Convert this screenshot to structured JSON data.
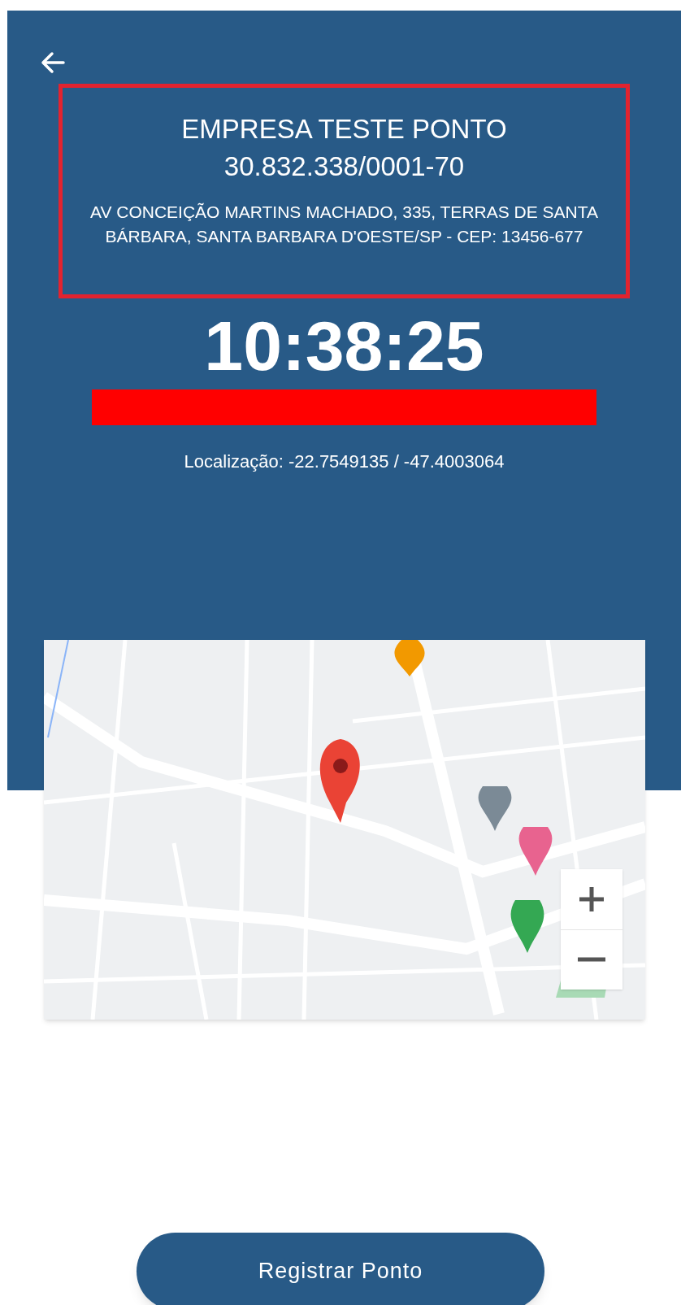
{
  "company": {
    "name": "EMPRESA TESTE PONTO",
    "cnpj": "30.832.338/0001-70",
    "address": "AV CONCEIÇÃO MARTINS MACHADO, 335, TERRAS DE SANTA BÁRBARA, SANTA BARBARA D'OESTE/SP - CEP: 13456-677"
  },
  "clock": "10:38:25",
  "location": "Localização: -22.7549135 / -47.4003064",
  "action_button": "Registrar Ponto"
}
